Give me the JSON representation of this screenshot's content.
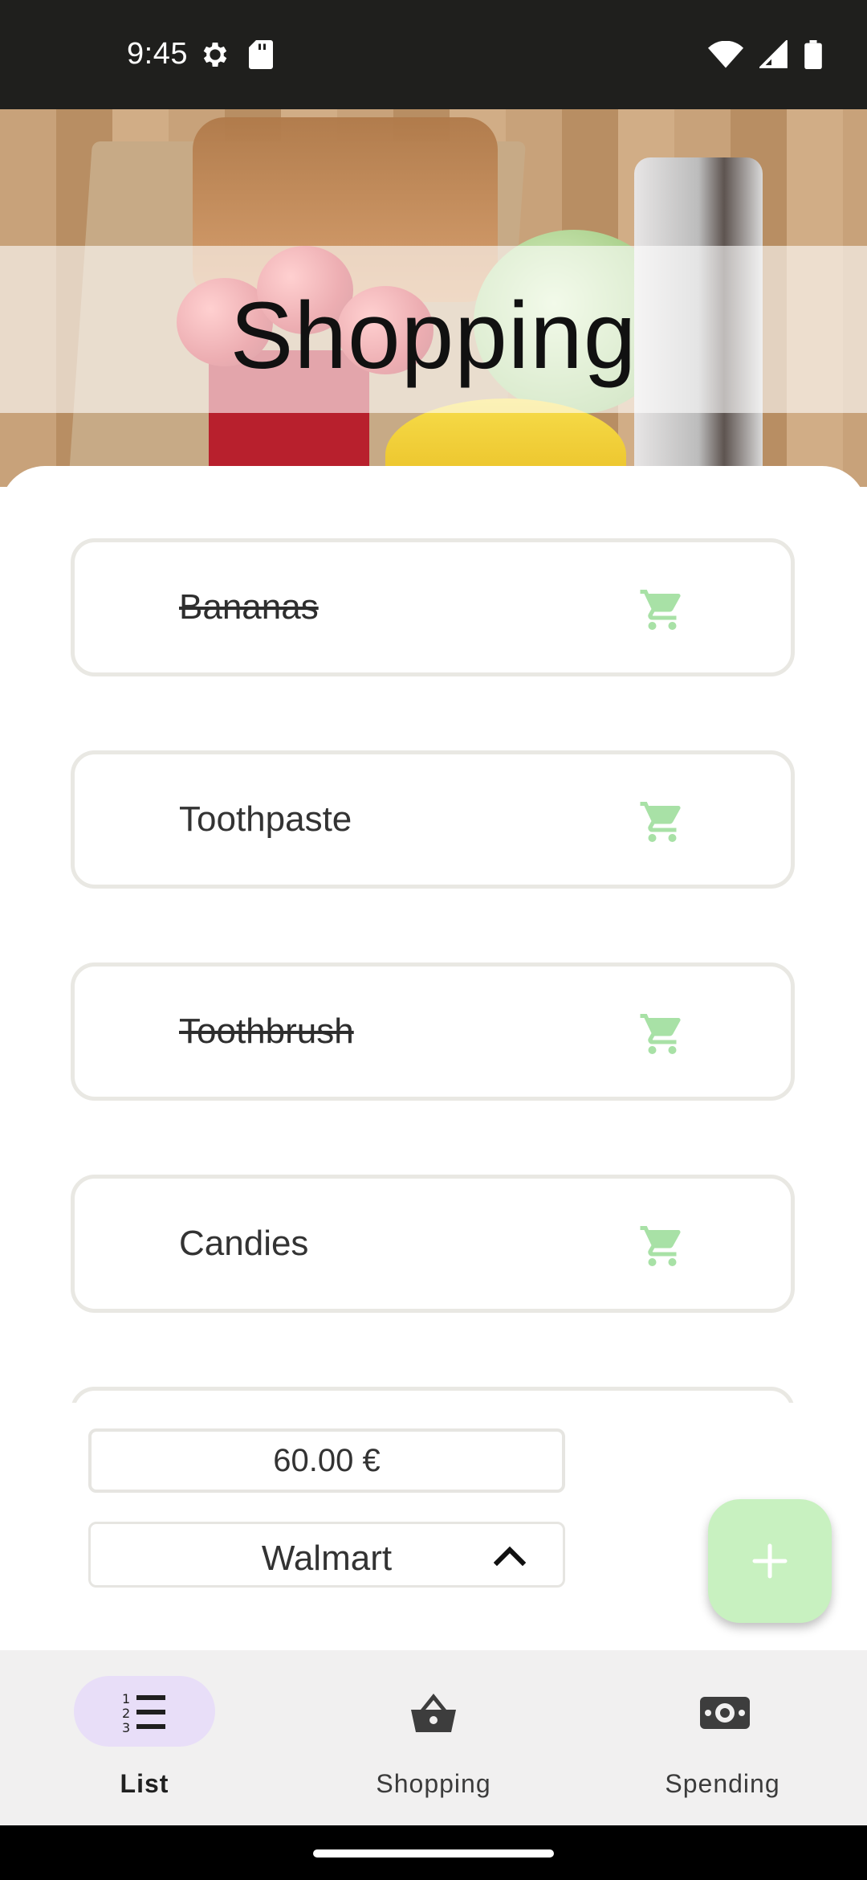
{
  "status_bar": {
    "time": "9:45"
  },
  "header": {
    "title": "Shopping"
  },
  "items": [
    {
      "label": "Bananas",
      "checked": true
    },
    {
      "label": "Toothpaste",
      "checked": false
    },
    {
      "label": "Toothbrush",
      "checked": true
    },
    {
      "label": "Candies",
      "checked": false
    }
  ],
  "footer": {
    "budget": "60.00 €",
    "store": "Walmart"
  },
  "nav": [
    {
      "label": "List",
      "icon": "list-icon",
      "active": true
    },
    {
      "label": "Shopping",
      "icon": "basket-icon",
      "active": false
    },
    {
      "label": "Spending",
      "icon": "money-icon",
      "active": false
    }
  ],
  "colors": {
    "cart_icon": "#a8e1a6",
    "fab": "#c8f1c0",
    "nav_active_pill": "#e8def8"
  }
}
